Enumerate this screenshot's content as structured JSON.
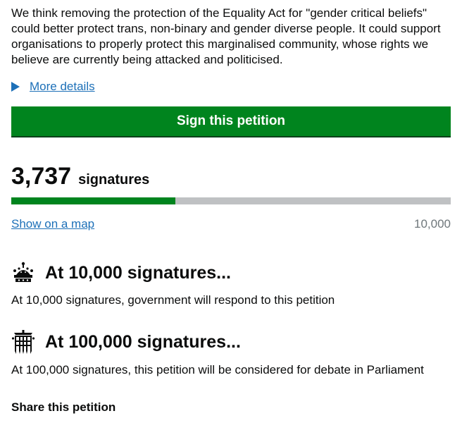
{
  "intro_text": "We think removing the protection of the Equality Act for \"gender critical beliefs\" could better protect trans, non-binary and gender diverse people. It could support organisations to properly protect this marginalised community, whose rights we believe are currently being attacked and politicised.",
  "more_details_label": "More details",
  "sign_button_label": "Sign this petition",
  "signatures": {
    "count": "3,737",
    "label": "signatures",
    "goal": "10,000",
    "progress_fraction": 0.3737,
    "show_map_label": "Show on a map"
  },
  "thresholds": [
    {
      "icon": "crown-icon",
      "heading": "At 10,000 signatures...",
      "text": "At 10,000 signatures, government will respond to this petition"
    },
    {
      "icon": "portcullis-icon",
      "heading": "At 100,000 signatures...",
      "text": "At 100,000 signatures, this petition will be considered for debate in Parliament"
    }
  ],
  "share_heading": "Share this petition",
  "colors": {
    "primary_green": "#00841e",
    "link_blue": "#1d70b8",
    "progress_track": "#bfc1c3"
  }
}
